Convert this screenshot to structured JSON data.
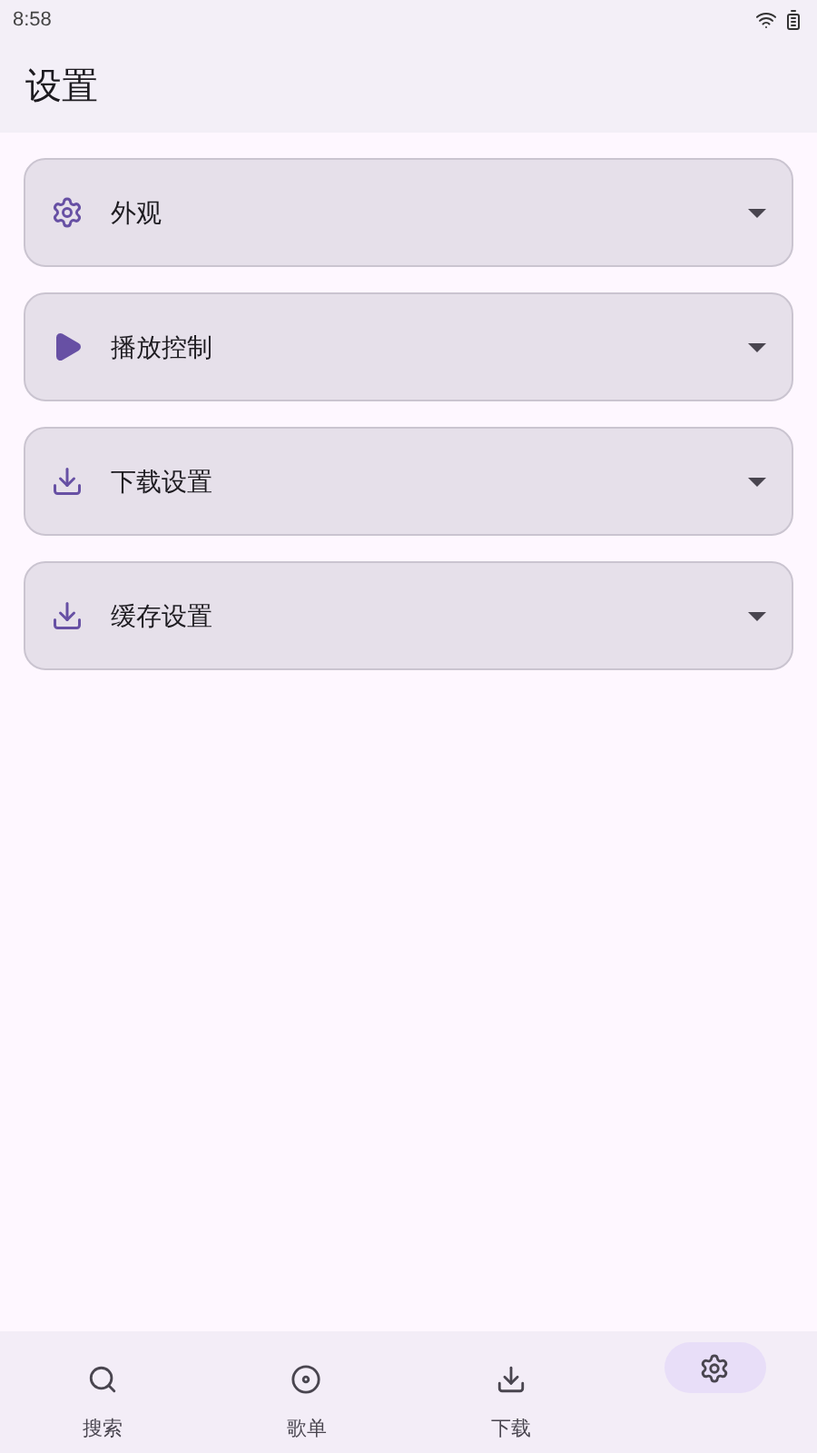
{
  "status_bar": {
    "time": "8:58"
  },
  "header": {
    "title": "设置"
  },
  "sections": [
    {
      "kind": "gear",
      "label": "外观",
      "expanded": false
    },
    {
      "kind": "play",
      "label": "播放控制",
      "expanded": false
    },
    {
      "kind": "download",
      "label": "下载设置",
      "expanded": false
    },
    {
      "kind": "download",
      "label": "缓存设置",
      "expanded": false
    }
  ],
  "nav": [
    {
      "kind": "search",
      "label": "搜索",
      "selected": false
    },
    {
      "kind": "disc",
      "label": "歌单",
      "selected": false
    },
    {
      "kind": "download",
      "label": "下载",
      "selected": false
    },
    {
      "kind": "gear",
      "selected": true
    }
  ]
}
